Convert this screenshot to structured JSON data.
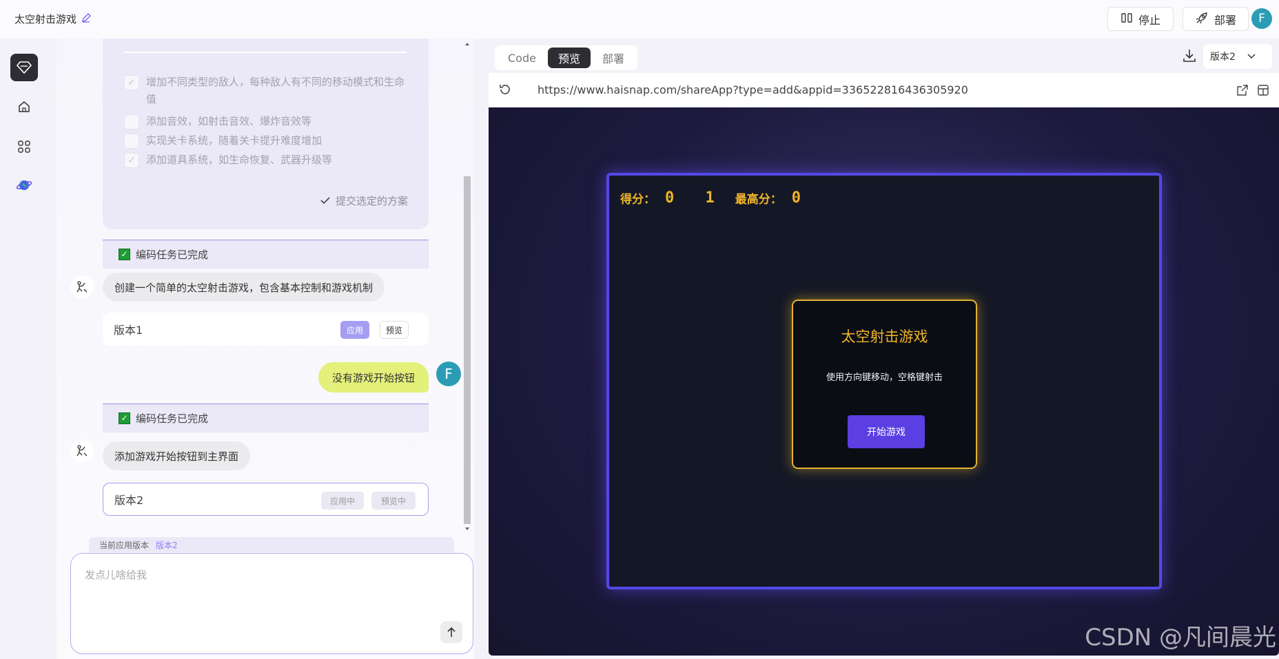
{
  "header": {
    "app_title": "太空射击游戏",
    "stop_label": "停止",
    "deploy_label": "部署",
    "user_initial": "F"
  },
  "plan": {
    "items": [
      {
        "label": "增加不同类型的敌人，每种敌人有不同的移动模式和生命值",
        "checked": true
      },
      {
        "label": "添加音效，如射击音效、爆炸音效等",
        "checked": false
      },
      {
        "label": "实现关卡系统，随着关卡提升难度增加",
        "checked": false
      },
      {
        "label": "添加道具系统，如生命恢复、武器升级等",
        "checked": true
      }
    ],
    "submit_label": "提交选定的方案"
  },
  "chat": {
    "task_done_label": "编码任务已完成",
    "msg1": "创建一个简单的太空射击游戏，包含基本控制和游戏机制",
    "version1": {
      "name": "版本1",
      "apply": "应用",
      "preview": "预览"
    },
    "user_msg": "没有游戏开始按钮",
    "user_initial": "F",
    "task_done_label_2": "编码任务已完成",
    "msg2": "添加游戏开始按钮到主界面",
    "version2": {
      "name": "版本2",
      "apply": "应用中",
      "preview": "预览中"
    },
    "current_version_label": "当前应用版本",
    "current_version_value": "版本2",
    "input_placeholder": "发点儿啥给我"
  },
  "preview": {
    "tabs": [
      "Code",
      "预览",
      "部署"
    ],
    "active_tab": 1,
    "version_select": "版本2",
    "url": "https://www.haisnap.com/shareApp?type=add&appid=336522816436305920"
  },
  "game": {
    "score_label": "得分：",
    "score_value": "0 1",
    "high_label": "最高分：",
    "high_value": "0",
    "title": "太空射击游戏",
    "instructions": "使用方向键移动，空格键射击",
    "start_button": "开始游戏"
  },
  "watermark": "CSDN @凡间晨光",
  "colors": {
    "accent": "#5448e6",
    "gold": "#f0b429",
    "user_bubble": "#e3f07a",
    "avatar": "#2a9db5"
  }
}
